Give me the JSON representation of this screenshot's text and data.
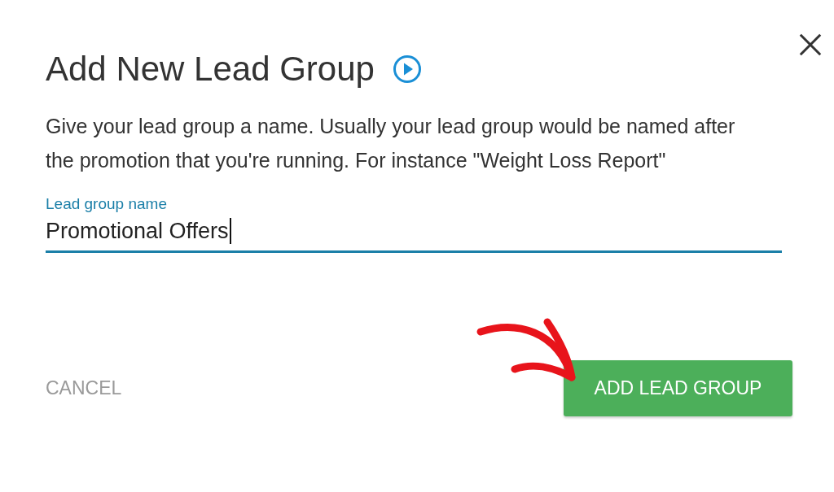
{
  "dialog": {
    "title": "Add New Lead Group",
    "description": "Give your lead group a name. Usually your lead group would be named after the promotion that you're running. For instance \"Weight Loss Report\""
  },
  "field": {
    "label": "Lead group name",
    "value": "Promotional Offers",
    "focused": true
  },
  "buttons": [
    {
      "label": "CANCEL",
      "kind": "text"
    },
    {
      "label": "ADD LEAD GROUP",
      "kind": "primary"
    }
  ]
}
